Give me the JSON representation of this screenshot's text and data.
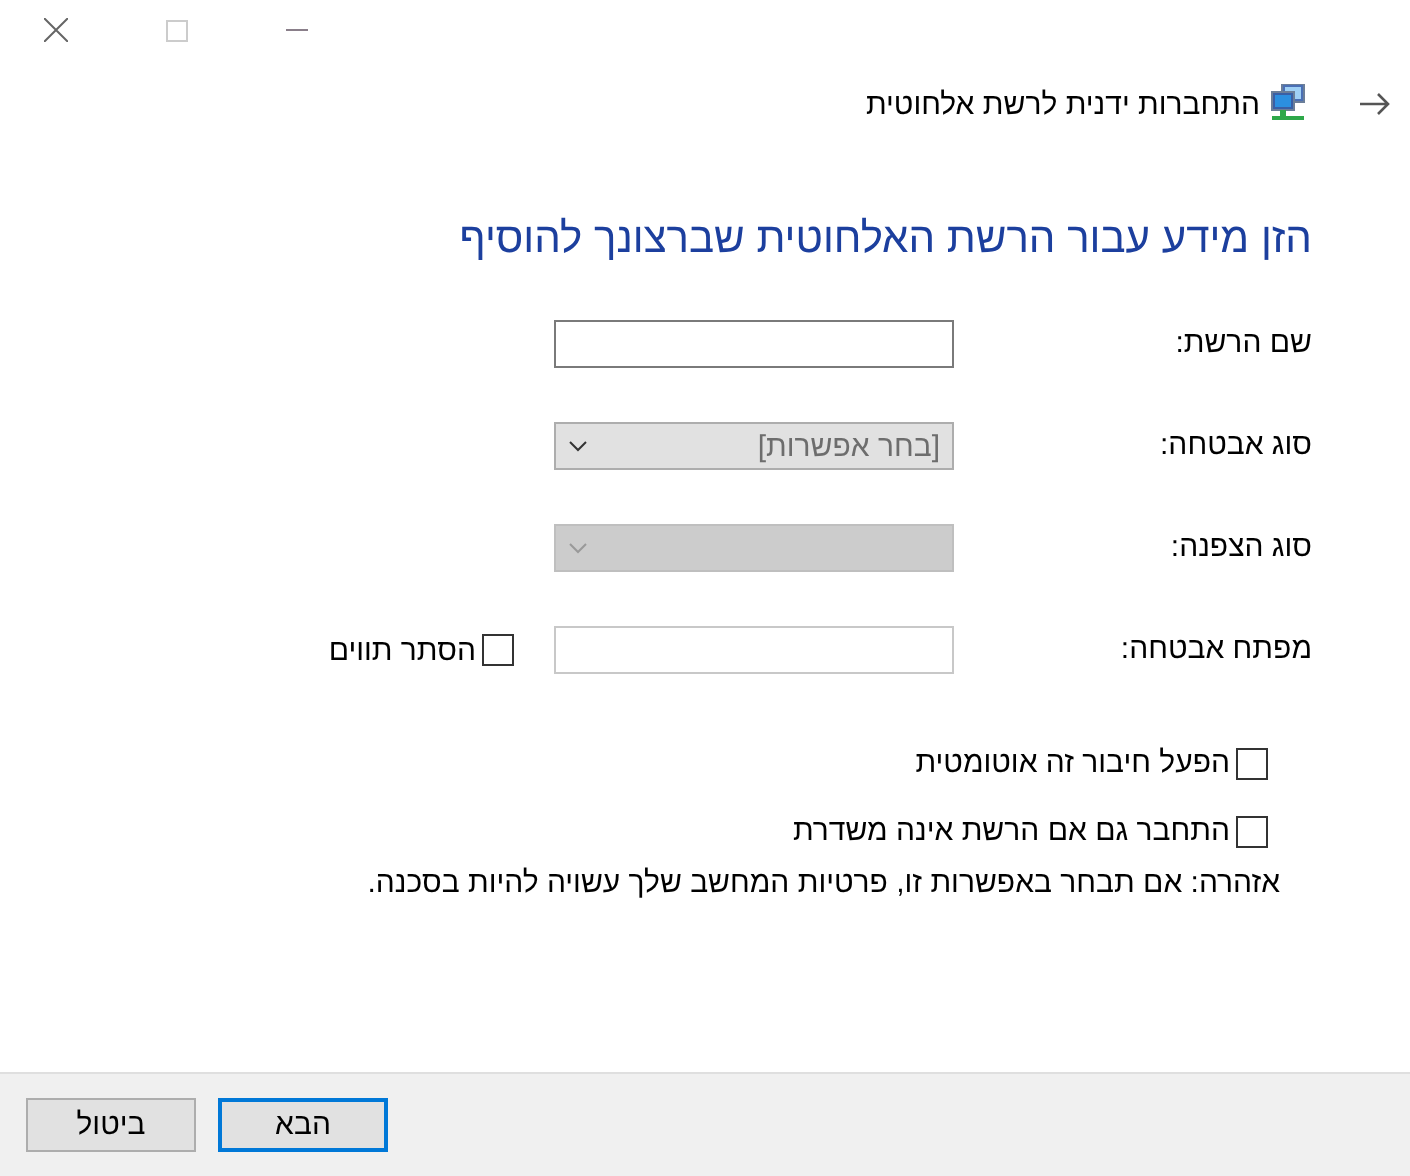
{
  "header": {
    "title": "התחברות ידנית לרשת אלחוטית"
  },
  "heading": "הזן מידע עבור הרשת האלחוטית שברצונך להוסיף",
  "fields": [
    {
      "label": "שם הרשת:",
      "kind": "text",
      "disabled": false
    },
    {
      "label": "סוג אבטחה:",
      "kind": "select",
      "value": "[בחר אפשרות]",
      "disabled": false
    },
    {
      "label": "סוג הצפנה:",
      "kind": "select",
      "disabled": true
    },
    {
      "label": "מפתח אבטחה:",
      "kind": "password",
      "disabled": false,
      "toggle": {
        "label": "הסתר תווים",
        "checked": false
      }
    }
  ],
  "options": [
    {
      "label": "הפעל חיבור זה אוטומטית",
      "checked": false
    },
    {
      "label": "התחבר גם אם הרשת אינה משדרת",
      "checked": false
    }
  ],
  "warning": "אזהרה: אם תבחר באפשרות זו, פרטיות המחשב שלך עשויה להיות בסכנה.",
  "buttons": [
    {
      "label": "הבא",
      "default": true
    },
    {
      "label": "ביטול",
      "default": false
    }
  ]
}
